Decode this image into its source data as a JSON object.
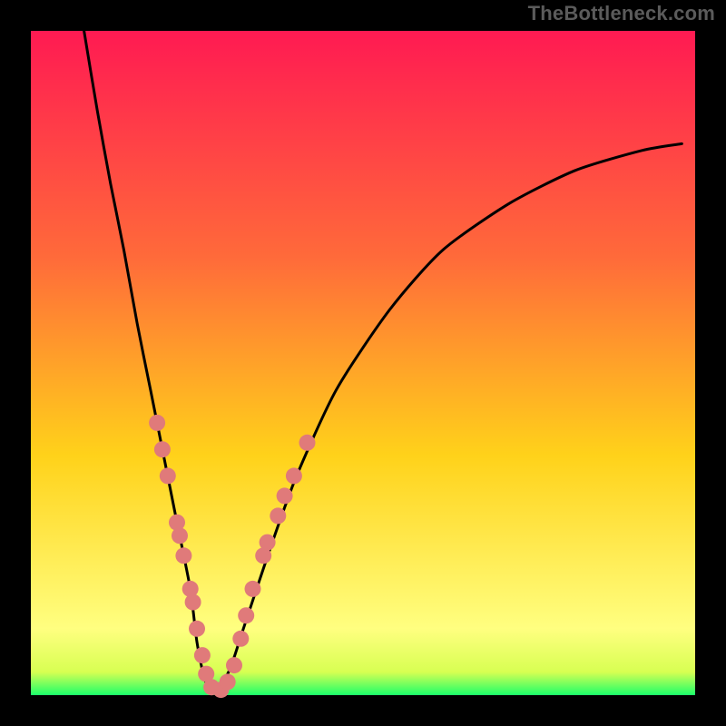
{
  "watermark": "TheBottleneck.com",
  "chart_data": {
    "type": "line",
    "title": "",
    "xlabel": "",
    "ylabel": "",
    "xlim": [
      0,
      100
    ],
    "ylim": [
      0,
      100
    ],
    "grid": false,
    "legend": false,
    "background_gradient": {
      "top": "#ff1a52",
      "upper": "#ff6a3a",
      "mid": "#ffd21a",
      "lower_band": "#ffff80",
      "base": "#1cff6a"
    },
    "series": [
      {
        "name": "bottleneck-curve",
        "x": [
          8,
          10,
          12,
          14,
          16,
          18,
          20,
          22,
          24,
          25,
          26,
          27,
          28,
          30,
          32,
          36,
          40,
          46,
          54,
          62,
          72,
          82,
          92,
          98
        ],
        "y": [
          100,
          88,
          77,
          67,
          56,
          46,
          36,
          26,
          16,
          8,
          3,
          0.5,
          0.5,
          4,
          10,
          22,
          33,
          46,
          58,
          67,
          74,
          79,
          82,
          83
        ]
      }
    ],
    "curve_smoothness": 0.12,
    "dots": {
      "name": "highlight-dots",
      "color": "#e07a7a",
      "radius": 9,
      "points": [
        {
          "x": 19.0,
          "y": 41
        },
        {
          "x": 19.8,
          "y": 37
        },
        {
          "x": 20.6,
          "y": 33
        },
        {
          "x": 22.0,
          "y": 26
        },
        {
          "x": 22.4,
          "y": 24
        },
        {
          "x": 23.0,
          "y": 21
        },
        {
          "x": 24.0,
          "y": 16
        },
        {
          "x": 24.4,
          "y": 14
        },
        {
          "x": 25.0,
          "y": 10
        },
        {
          "x": 25.8,
          "y": 6
        },
        {
          "x": 26.4,
          "y": 3.2
        },
        {
          "x": 27.2,
          "y": 1.2
        },
        {
          "x": 28.6,
          "y": 0.8
        },
        {
          "x": 29.6,
          "y": 2.0
        },
        {
          "x": 30.6,
          "y": 4.5
        },
        {
          "x": 31.6,
          "y": 8.5
        },
        {
          "x": 32.4,
          "y": 12
        },
        {
          "x": 33.4,
          "y": 16
        },
        {
          "x": 35.0,
          "y": 21
        },
        {
          "x": 35.6,
          "y": 23
        },
        {
          "x": 37.2,
          "y": 27
        },
        {
          "x": 38.2,
          "y": 30
        },
        {
          "x": 39.6,
          "y": 33
        },
        {
          "x": 41.6,
          "y": 38
        }
      ]
    }
  }
}
